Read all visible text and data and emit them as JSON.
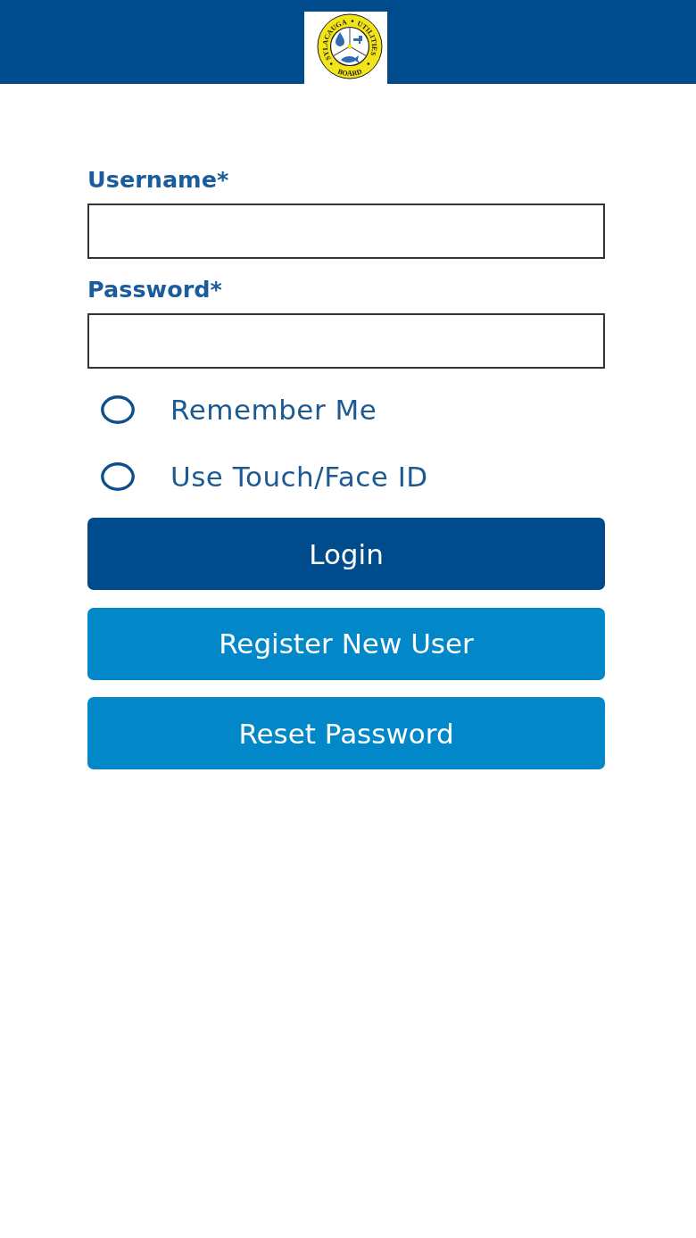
{
  "header": {
    "logo": {
      "ring_text": [
        {
          "text": "SYLACAUGA",
          "kind": "left"
        },
        {
          "text": "UTILITIES",
          "kind": "right"
        },
        {
          "text": "BOARD",
          "kind": "bottom"
        }
      ]
    }
  },
  "form": {
    "fields": [
      {
        "label": "Username*"
      },
      {
        "label": "Password*"
      }
    ],
    "options": [
      {
        "label": "Remember Me",
        "checked": false
      },
      {
        "label": "Use Touch/Face ID",
        "checked": false
      }
    ],
    "buttons": [
      {
        "label": "Login",
        "kind": "primary"
      },
      {
        "label": "Register New User",
        "kind": "secondary"
      },
      {
        "label": "Reset Password",
        "kind": "secondary"
      }
    ]
  }
}
